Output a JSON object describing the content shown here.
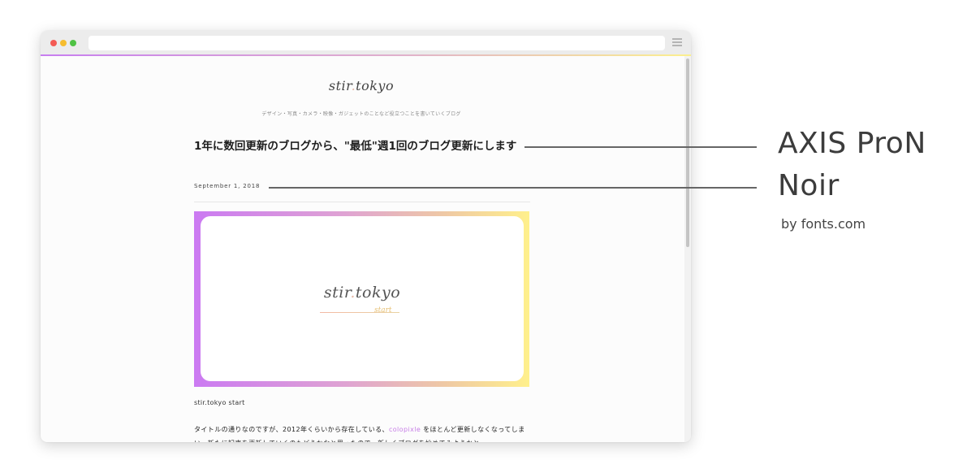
{
  "browser": {
    "traffic_lights": [
      "close",
      "minimize",
      "zoom"
    ],
    "menu_icon": "hamburger-icon",
    "accent_gradient": [
      "#c77ef0",
      "#e0b0cc",
      "#fbef8e"
    ]
  },
  "site": {
    "logo_main": "stir",
    "logo_dot": ".",
    "logo_rest": "tokyo",
    "tagline": "デザイン・写真・カメラ・映像・ガジェットのことなど役立つことを書いていくブログ"
  },
  "post": {
    "title": "1年に数回更新のブログから、\"最低\"週1回のブログ更新にします",
    "date": "September 1, 2018",
    "hero": {
      "logo_main": "stir",
      "logo_dot": ".",
      "logo_rest": "tokyo",
      "sub": "start"
    },
    "caption": "stir.tokyo start",
    "body_before_link": "タイトルの通りなのですが、2012年くらいから存在している、",
    "body_link": "colopixle",
    "body_after_link": " をほとんど更新しなくなってしまい、新たに記事を更新していくのもどうかなと思ったので、新しくブログを始めてみようかと"
  },
  "annotation": {
    "font_line1": "AXIS ProN",
    "font_line2": "Noir",
    "credit": "by  fonts.com"
  }
}
